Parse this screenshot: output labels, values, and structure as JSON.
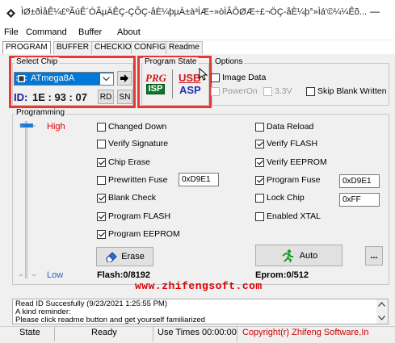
{
  "window": {
    "title": "ÌØ±ðÌåÊ¼£ºÃúÊ´ÓÃµÄÊÇ-ÇÕÇ-åÈ¼þµÄ±à³ÌÆ÷»òÌÂÔØÆ÷£¬ÖÇ-åÈ¼þ°»Ìá'©¼¼Êõ...",
    "minimize_glyph": "—"
  },
  "menu": [
    "File",
    "Command",
    "Buffer",
    "About"
  ],
  "tabs": [
    "PROGRAM",
    "BUFFER",
    "CHECKIO",
    "CONFIG",
    "Readme"
  ],
  "select_chip": {
    "label": "Select Chip",
    "value": "ATmega8A",
    "id_label": "ID:",
    "id_value": "1E : 93 : 07",
    "rd_button": "RD",
    "sn_button": "SN"
  },
  "program_state": {
    "label": "Program State",
    "logo_prg": "PRG",
    "logo_isp": "ISP",
    "logo_usb": "USB",
    "logo_asp": "ASP"
  },
  "options": {
    "label": "Options",
    "image_data": "Image Data",
    "power_on": "PowerOn",
    "voltage": "3.3V",
    "skip_blank": "Skip Blank Written"
  },
  "programming": {
    "label": "Programming",
    "high": "High",
    "low": "Low",
    "colors": {
      "high": "#e00000",
      "low": "#1e64c8"
    }
  },
  "checkboxes_left": [
    {
      "label": "Changed Down",
      "checked": false
    },
    {
      "label": "Verify Signature",
      "checked": false
    },
    {
      "label": "Chip Erase",
      "checked": true
    },
    {
      "label": "Prewritten Fuse",
      "checked": false
    },
    {
      "label": "Blank Check",
      "checked": true
    },
    {
      "label": "Program FLASH",
      "checked": true
    },
    {
      "label": "Program EEPROM",
      "checked": true
    }
  ],
  "checkboxes_right": [
    {
      "label": "Data Reload",
      "checked": false
    },
    {
      "label": "Verify FLASH",
      "checked": true
    },
    {
      "label": "Verify EEPROM",
      "checked": true
    },
    {
      "label": "Program Fuse",
      "checked": true
    },
    {
      "label": "Lock Chip",
      "checked": false
    },
    {
      "label": "Enabled XTAL",
      "checked": false
    }
  ],
  "fields": {
    "prewritten_fuse": "0xD9E1",
    "program_fuse": "0xD9E1",
    "lock_chip": "0xFF"
  },
  "buttons": {
    "erase": "Erase",
    "auto": "Auto",
    "more": "..."
  },
  "flash_info": "Flash:0/8192",
  "eprom_info": "Eprom:0/512",
  "watermark": "www.zhifengsoft.com",
  "log": [
    "Read ID Succesfully (9/23/2021 1:25:55 PM)",
    "A kind reminder:",
    "Please click readme button and get yourself familiarized"
  ],
  "status": {
    "state_label": "State",
    "state_value": "Ready",
    "use_times_label": "Use Times",
    "use_times_value": "00:00:00",
    "copyright": "Copyright(r) Zhifeng Software,In"
  }
}
